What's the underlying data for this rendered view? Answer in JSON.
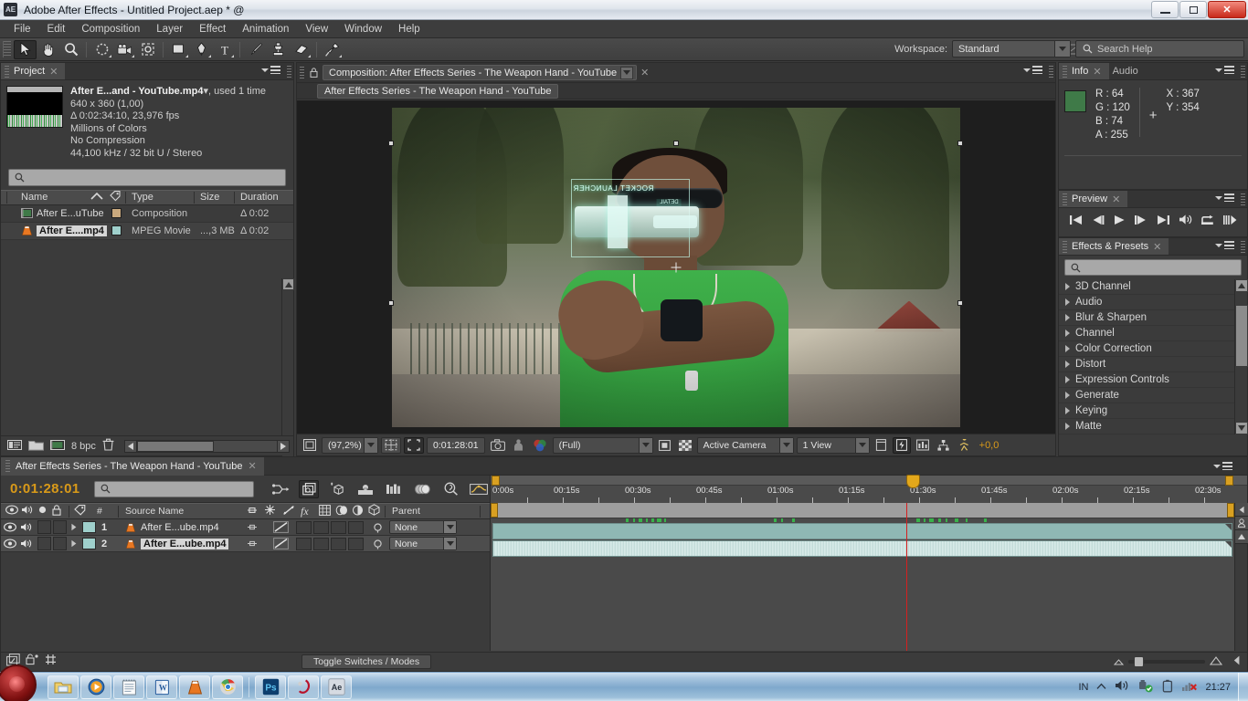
{
  "window": {
    "app_badge": "AE",
    "title": "Adobe After Effects - Untitled Project.aep * @",
    "minimize": "minimize",
    "restore": "restore",
    "close": "✕"
  },
  "menubar": {
    "items": [
      "File",
      "Edit",
      "Composition",
      "Layer",
      "Effect",
      "Animation",
      "View",
      "Window",
      "Help"
    ]
  },
  "toolbar": {
    "tools": [
      {
        "name": "selection-tool",
        "active": true
      },
      {
        "name": "hand-tool",
        "active": false
      },
      {
        "name": "zoom-tool",
        "active": false
      },
      {
        "name": "orbit-camera-tool",
        "active": false
      },
      {
        "name": "camera-tool",
        "active": false
      },
      {
        "name": "pan-behind-tool",
        "active": false
      },
      {
        "name": "shape-tool",
        "active": false
      },
      {
        "name": "pen-tool",
        "active": false
      },
      {
        "name": "type-tool",
        "active": false
      },
      {
        "name": "brush-tool",
        "active": false
      },
      {
        "name": "clone-stamp-tool",
        "active": false
      },
      {
        "name": "eraser-tool",
        "active": false
      },
      {
        "name": "puppet-pin-tool",
        "active": false
      }
    ],
    "workspace_label": "Workspace:",
    "workspace_value": "Standard",
    "search_help_placeholder": "Search Help"
  },
  "project_panel": {
    "tab_label": "Project",
    "asset": {
      "name": "After E...and - YouTube.mp4",
      "used": ", used 1 time",
      "resolution": "640 x 360 (1,00)",
      "duration": "Δ 0:02:34:10, 23,976 fps",
      "colors": "Millions of Colors",
      "compression": "No Compression",
      "audio": "44,100 kHz / 32 bit U / Stereo"
    },
    "search_placeholder": "",
    "columns": [
      "Name",
      "Type",
      "Size",
      "Duration"
    ],
    "rows": [
      {
        "name": "After E...uTube",
        "type": "Composition",
        "size": "",
        "duration": "Δ 0:02",
        "selected": false,
        "icon": "composition-icon",
        "swatch": "#c9a97e"
      },
      {
        "name": "After E....mp4",
        "type": "MPEG Movie",
        "size": "...,3 MB",
        "duration": "Δ 0:02",
        "selected": true,
        "icon": "vlc-icon",
        "swatch": "#9fd0cc"
      }
    ],
    "bit_depth": "8 bpc"
  },
  "composition_panel": {
    "tab_label": "Composition: After Effects Series - The Weapon Hand - YouTube",
    "sub_tab_label": "After Effects Series - The Weapon Hand - YouTube",
    "viewport": {
      "hud_text": "ROCKET LAUNCHER",
      "hud_text_small": "DETAIL"
    },
    "bottom_bar": {
      "zoom": "(97,2%)",
      "timecode": "0:01:28:01",
      "resolution": "(Full)",
      "camera": "Active Camera",
      "views": "1 View",
      "exposure": "+0,0"
    }
  },
  "info_panel": {
    "tabs": [
      "Info",
      "Audio"
    ],
    "selected_tab": "Info",
    "r_label": "R :",
    "r_value": "64",
    "g_label": "G :",
    "g_value": "120",
    "b_label": "B :",
    "b_value": "74",
    "a_label": "A :",
    "a_value": "255",
    "x_label": "X :",
    "x_value": "367",
    "y_label": "Y :",
    "y_value": "354",
    "swatch_color": "#3f7a48"
  },
  "preview_panel": {
    "tab_label": "Preview",
    "buttons": [
      "first-frame",
      "previous-frame",
      "play",
      "next-frame",
      "last-frame",
      "audio",
      "loop",
      "ram-preview"
    ]
  },
  "effects_panel": {
    "tab_label": "Effects & Presets",
    "search_placeholder": "",
    "items": [
      "3D Channel",
      "Audio",
      "Blur & Sharpen",
      "Channel",
      "Color Correction",
      "Distort",
      "Expression Controls",
      "Generate",
      "Keying",
      "Matte"
    ]
  },
  "timeline_panel": {
    "tab_label": "After Effects Series - The Weapon Hand - YouTube",
    "current_time": "0:01:28:01",
    "search_placeholder": "",
    "columns": {
      "number": "#",
      "source_name": "Source Name",
      "parent": "Parent"
    },
    "layers": [
      {
        "index": "1",
        "name": "After E...ube.mp4",
        "parent": "None",
        "selected": false
      },
      {
        "index": "2",
        "name": "After E...ube.mp4",
        "parent": "None",
        "selected": true
      }
    ],
    "ruler_ticks": [
      "0:00s",
      "00:15s",
      "00:30s",
      "00:45s",
      "01:00s",
      "01:15s",
      "01:30s",
      "01:45s",
      "02:00s",
      "02:15s",
      "02:30s"
    ],
    "toggle_switches_modes": "Toggle Switches / Modes"
  },
  "taskbar": {
    "start_label": "Start",
    "items": [
      {
        "name": "windows-explorer-icon",
        "label": "Explorer"
      },
      {
        "name": "media-player-icon",
        "label": "Media Player"
      },
      {
        "name": "notepad-icon",
        "label": "Notepad"
      },
      {
        "name": "word-icon",
        "label": "Word"
      },
      {
        "name": "vlc-icon",
        "label": "VLC"
      },
      {
        "name": "chrome-icon",
        "label": "Chrome"
      },
      {
        "name": "photoshop-icon",
        "label": "Ps"
      },
      {
        "name": "acrobat-icon",
        "label": "Acrobat"
      },
      {
        "name": "after-effects-icon",
        "label": "Ae"
      }
    ],
    "tray": {
      "language": "IN",
      "clock": "21:27"
    }
  }
}
